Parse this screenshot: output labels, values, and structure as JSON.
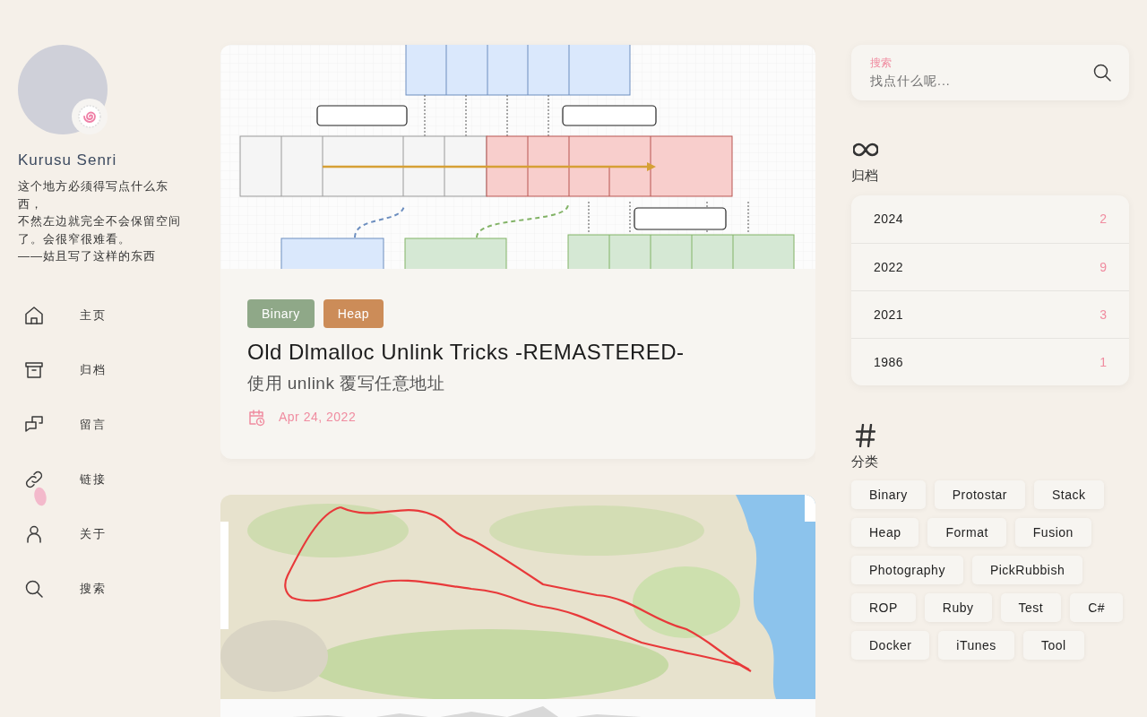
{
  "sidebar": {
    "profile": {
      "name": "Kurusu Senri",
      "description": [
        "这个地方必须得写点什么东西，",
        "不然左边就完全不会保留空间了。会很窄很难看。",
        "——姑且写了这样的东西"
      ]
    },
    "nav": [
      {
        "label": "主页"
      },
      {
        "label": "归档"
      },
      {
        "label": "留言"
      },
      {
        "label": "链接"
      },
      {
        "label": "关于"
      },
      {
        "label": "搜索"
      }
    ]
  },
  "posts": [
    {
      "kind": "diagram",
      "tags": [
        {
          "label": "Binary",
          "color": "#8fa888"
        },
        {
          "label": "Heap",
          "color": "#cc8c58"
        }
      ],
      "title": "Old Dlmalloc Unlink Tricks -REMASTERED-",
      "subtitle": "使用 unlink 覆写任意地址",
      "date": "Apr 24, 2022"
    },
    {
      "kind": "map"
    }
  ],
  "search": {
    "label": "搜索",
    "placeholder": "找点什么呢..."
  },
  "archive": {
    "title": "归档",
    "rows": [
      {
        "year": "2024",
        "count": "2"
      },
      {
        "year": "2022",
        "count": "9"
      },
      {
        "year": "2021",
        "count": "3"
      },
      {
        "year": "1986",
        "count": "1"
      }
    ]
  },
  "categories": {
    "title": "分类",
    "tags": [
      "Binary",
      "Protostar",
      "Stack",
      "Heap",
      "Format",
      "Fusion",
      "Photography",
      "PickRubbish",
      "ROP",
      "Ruby",
      "Test",
      "C#",
      "Docker",
      "iTunes",
      "Tool"
    ]
  }
}
